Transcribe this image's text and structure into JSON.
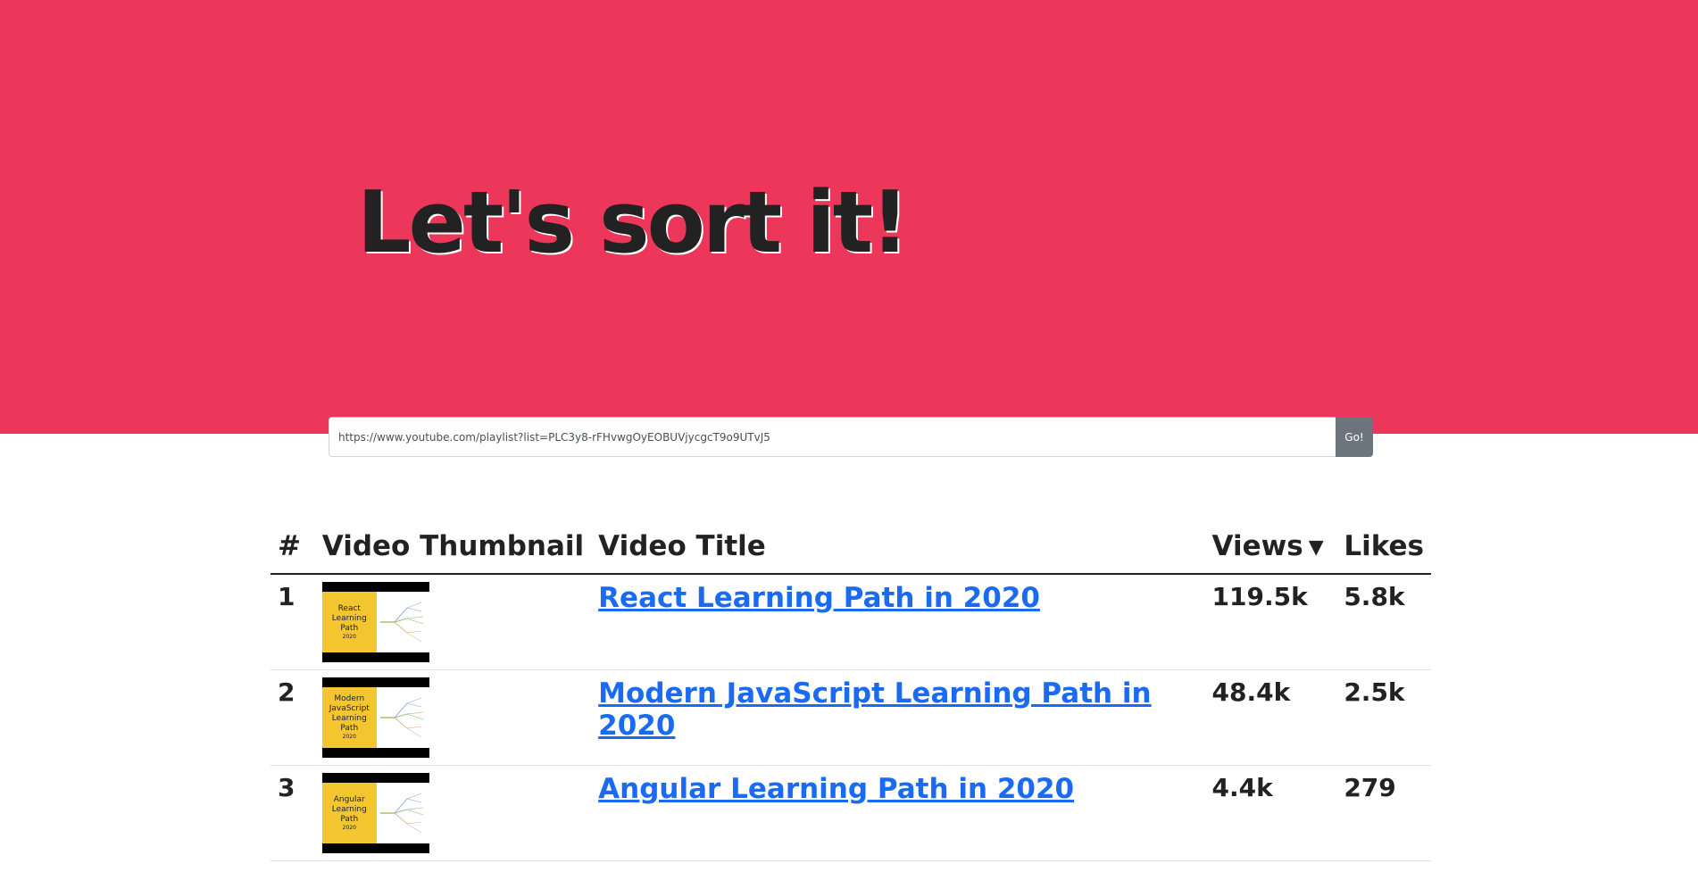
{
  "hero": {
    "title": "Let's sort it!",
    "color": "#ec375b"
  },
  "search": {
    "value": "https://www.youtube.com/playlist?list=PLC3y8-rFHvwgOyEOBUVjycgcT9o9UTvJ5",
    "button_label": "Go!"
  },
  "table": {
    "columns": [
      "#",
      "Video Thumbnail",
      "Video Title",
      "Views",
      "Likes"
    ],
    "sorted_by": "Views",
    "sort_direction": "descending",
    "rows": [
      {
        "num": "1",
        "title": "React Learning Path in 2020",
        "views": "119.5k",
        "likes": "5.8k",
        "thumb_text": [
          "React",
          "Learning",
          "Path",
          "2020"
        ]
      },
      {
        "num": "2",
        "title": "Modern JavaScript Learning Path in 2020",
        "views": "48.4k",
        "likes": "2.5k",
        "thumb_text": [
          "Modern",
          "JavaScript",
          "Learning",
          "Path",
          "2020"
        ]
      },
      {
        "num": "3",
        "title": "Angular Learning Path in 2020",
        "views": "4.4k",
        "likes": "279",
        "thumb_text": [
          "Angular",
          "Learning",
          "Path",
          "2020"
        ]
      }
    ]
  },
  "colors": {
    "link": "#1a6bf2",
    "go_button": "#6c757d",
    "thumbnail_accent": "#f3c630"
  }
}
